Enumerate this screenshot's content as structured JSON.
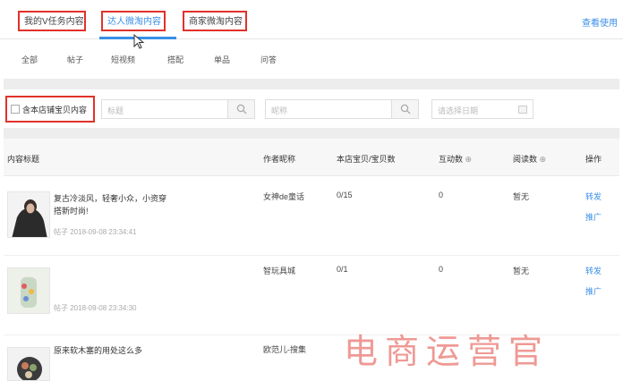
{
  "tabs": [
    {
      "label": "我的V任务内容",
      "active": false
    },
    {
      "label": "达人微淘内容",
      "active": true
    },
    {
      "label": "商家微淘内容",
      "active": false
    }
  ],
  "help_link": "查看使用",
  "filters": [
    "全部",
    "帖子",
    "短视频",
    "搭配",
    "单品",
    "问答"
  ],
  "search": {
    "checkbox_label": "含本店铺宝贝内容",
    "title_placeholder": "标题",
    "nickname_placeholder": "昵称",
    "date_placeholder": "请选择日期"
  },
  "table": {
    "headers": [
      "内容标题",
      "作者昵称",
      "本店宝贝/宝贝数",
      "互动数",
      "阅读数",
      "操作"
    ],
    "rows": [
      {
        "title": "复古冷淡风，轻奢小众，小资穿搭新时尚!",
        "meta": "帖子 2018-09-08 23:34:41",
        "author": "女神de童话",
        "products": "0/15",
        "interactions": "0",
        "reads": "暂无",
        "actions": [
          "转发",
          "推广"
        ]
      },
      {
        "title": "",
        "meta": "帖子 2018-09-08 23:34:30",
        "author": "智玩具城",
        "products": "0/1",
        "interactions": "0",
        "reads": "暂无",
        "actions": [
          "转发",
          "推广"
        ]
      },
      {
        "title": "原来软木塞的用处这么多",
        "meta": "",
        "author": "欧范儿-搜集",
        "products": "",
        "interactions": "",
        "reads": "",
        "actions": []
      }
    ]
  },
  "watermark": "电商运营官",
  "colors": {
    "accent": "#3a8ee6",
    "highlight_box": "#e0322b",
    "band": "#ededed"
  }
}
